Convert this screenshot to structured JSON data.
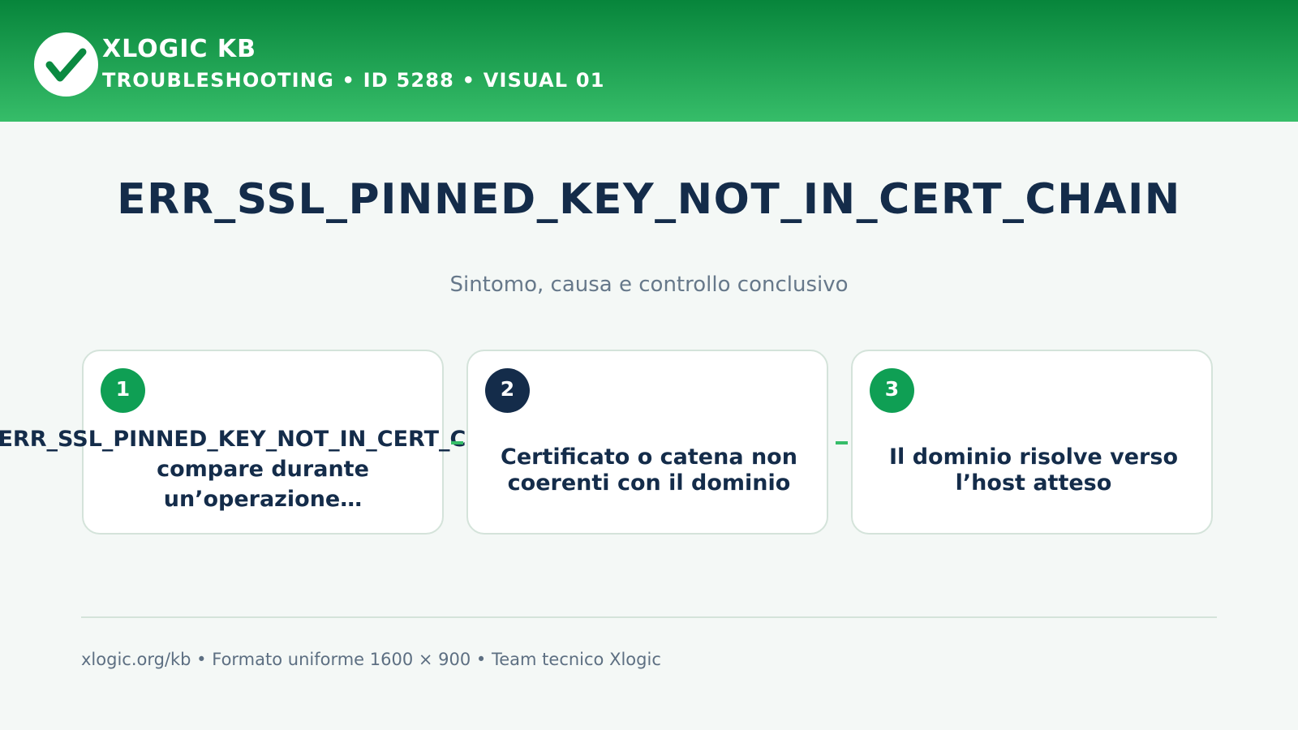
{
  "header": {
    "brand": "XLOGIC KB",
    "subtitle": "TROUBLESHOOTING • ID 5288 • VISUAL 01",
    "logo_icon": "checkmark-icon",
    "colors": {
      "gradient_top": "#07853b",
      "gradient_bottom": "#36bd69"
    }
  },
  "main": {
    "title": "ERR_SSL_PINNED_KEY_NOT_IN_CERT_CHAIN",
    "subtitle": "Sintomo, causa e controllo conclusivo"
  },
  "steps": [
    {
      "number": "1",
      "line1": "ERR_SSL_PINNED_KEY_NOT_IN_CERT_CHAIN",
      "line2": "compare durante",
      "line3": "un’operazione…",
      "badge_color": "#0f9f54"
    },
    {
      "number": "2",
      "line1": "Certificato o catena non",
      "line2": "coerenti con il dominio",
      "badge_color": "#142c4a"
    },
    {
      "number": "3",
      "line1": "Il dominio risolve verso",
      "line2": "l’host atteso",
      "badge_color": "#0f9f54"
    }
  ],
  "footer": {
    "text": "xlogic.org/kb • Formato uniforme 1600 × 900 • Team tecnico Xlogic"
  }
}
